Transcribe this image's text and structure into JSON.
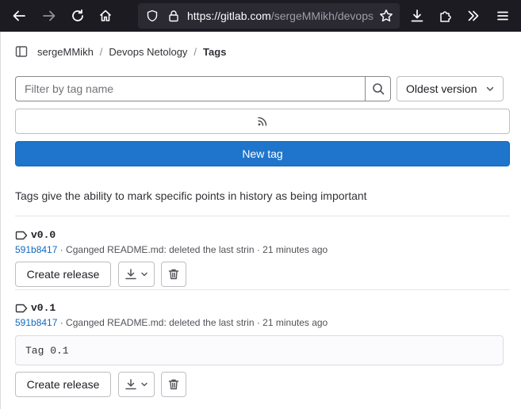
{
  "browser": {
    "url_host": "https://gitlab.com",
    "url_path": "/sergeMMikh/devops"
  },
  "breadcrumb": {
    "items": [
      "sergeMMikh",
      "Devops Netology",
      "Tags"
    ]
  },
  "filter": {
    "placeholder": "Filter by tag name",
    "value": ""
  },
  "sort": {
    "selected": "Oldest version"
  },
  "new_tag_label": "New tag",
  "description": "Tags give the ability to mark specific points in history as being important",
  "tags": [
    {
      "name": "v0.0",
      "sha": "591b8417",
      "commit_text": " · Cganged README.md: deleted the last strin · 21 minutes ago",
      "release_note": "",
      "create_release_label": "Create release"
    },
    {
      "name": "v0.1",
      "sha": "591b8417",
      "commit_text": " · Cganged README.md: deleted the last strin · 21 minutes ago",
      "release_note": "Tag 0.1",
      "create_release_label": "Create release"
    }
  ],
  "colors": {
    "primary": "#1f75cb",
    "link": "#1068bf",
    "chrome_bg": "#1c1b22"
  }
}
